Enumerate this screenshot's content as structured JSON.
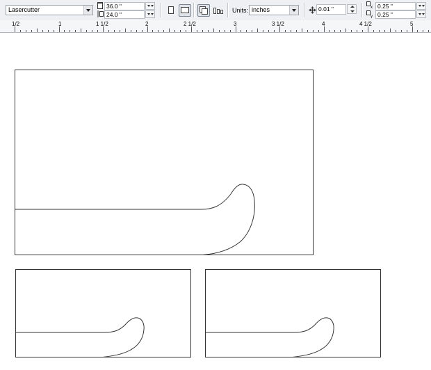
{
  "toolbar": {
    "preset": "Lasercutter",
    "width": "36.0 \"",
    "height": "24.0 \"",
    "units_label": "Units:",
    "units_value": "inches",
    "nudge": "0.01 \"",
    "duplicate_x": "0.25 \"",
    "duplicate_y": "0.25 \""
  },
  "ruler": {
    "labels": [
      "1/2",
      "1",
      "1 1/2",
      "2",
      "2 1/2",
      "3",
      "3 1/2",
      "4",
      "4 1/2",
      "5"
    ]
  },
  "icons": [
    "page-width-icon",
    "page-height-icon",
    "portrait-icon",
    "landscape-icon",
    "all-pages-icon",
    "current-page-icon",
    "nudge-icon",
    "duplicate-x-icon",
    "duplicate-y-icon"
  ]
}
